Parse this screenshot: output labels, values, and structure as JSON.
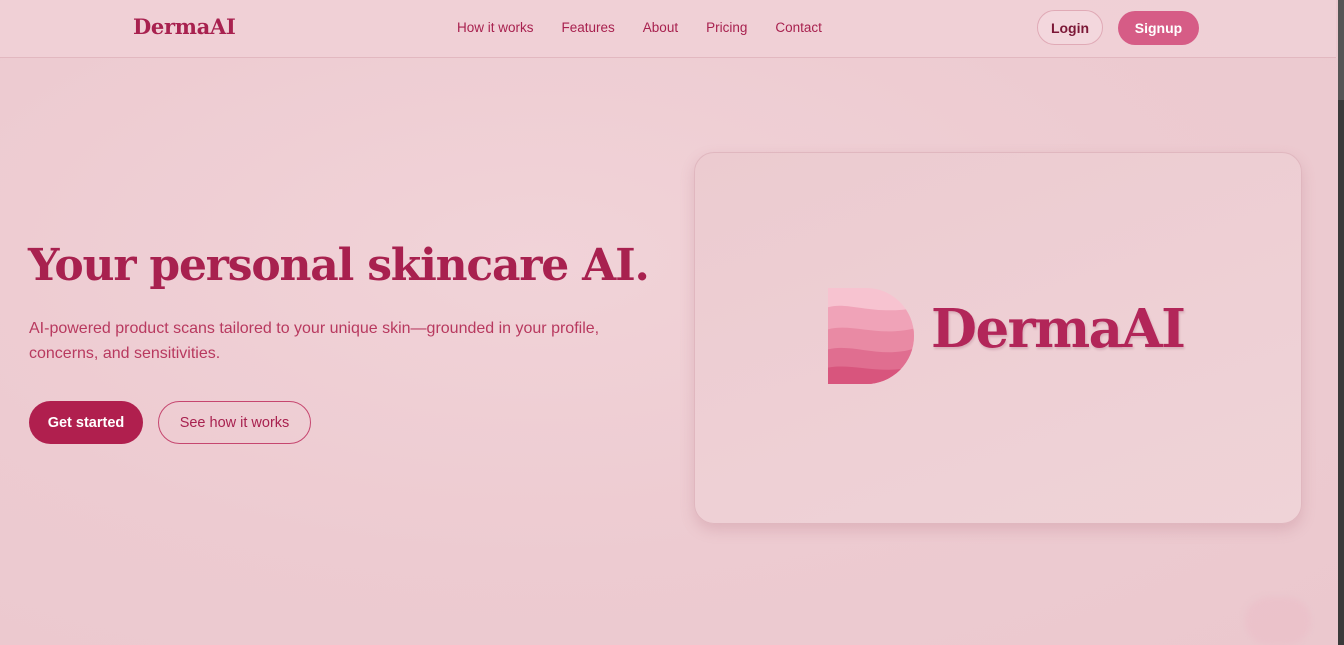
{
  "nav": {
    "brand": "DermaAI",
    "links": [
      "How it works",
      "Features",
      "About",
      "Pricing",
      "Contact"
    ],
    "login_label": "Login",
    "signup_label": "Signup"
  },
  "hero": {
    "title": "Your personal skincare AI.",
    "subtitle_line1": "AI-powered product scans tailored to your unique skin—grounded in your profile,",
    "subtitle_line2": "concerns, and sensitivities.",
    "primary_cta": "Get started",
    "secondary_cta": "See how it works"
  },
  "showcase": {
    "logo_icon": "layered-d-logo-icon",
    "wordmark": "DermaAI"
  },
  "colors": {
    "brand": "#a8214f",
    "accent": "#d65c86",
    "background": "#efcfd4"
  }
}
